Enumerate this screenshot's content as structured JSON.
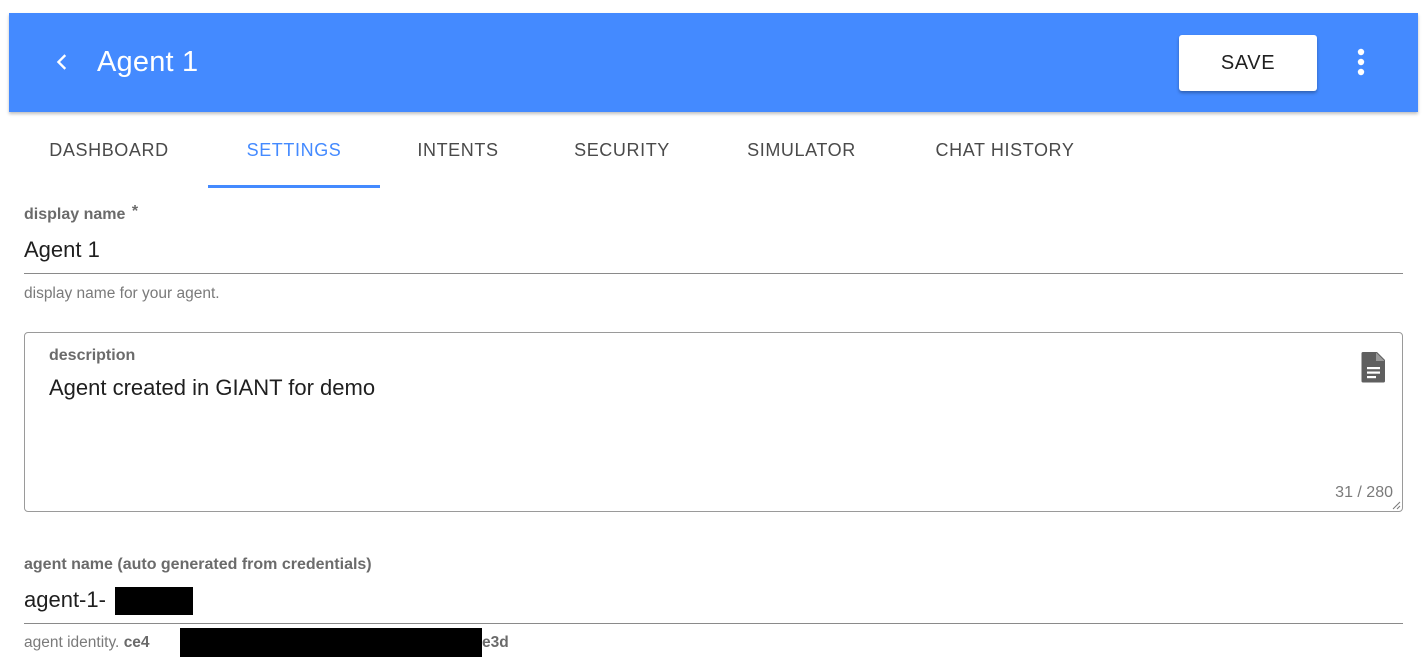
{
  "header": {
    "title": "Agent 1",
    "save_label": "SAVE",
    "back_icon": "chevron-left-icon",
    "more_icon": "more-vert-icon",
    "accent_color": "#448aff"
  },
  "tabs": [
    {
      "label": "DASHBOARD",
      "active": false
    },
    {
      "label": "SETTINGS",
      "active": true
    },
    {
      "label": "INTENTS",
      "active": false
    },
    {
      "label": "SECURITY",
      "active": false
    },
    {
      "label": "SIMULATOR",
      "active": false
    },
    {
      "label": "CHAT HISTORY",
      "active": false
    }
  ],
  "form": {
    "display_name": {
      "label": "display name",
      "required_mark": "*",
      "value": "Agent 1",
      "hint": "display name for your agent."
    },
    "description": {
      "label": "description",
      "value": "Agent created in GIANT for demo",
      "counter": "31 / 280",
      "icon": "document-icon"
    },
    "agent_name": {
      "label": "agent name (auto generated from credentials)",
      "value_prefix": "agent-1-",
      "hint_prefix": "agent identity.",
      "identity_start": "ce4",
      "identity_end": "e3d"
    }
  }
}
